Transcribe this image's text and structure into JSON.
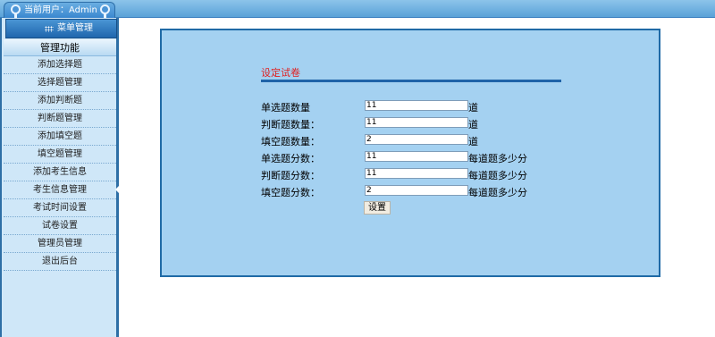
{
  "header": {
    "user_label": "当前用户：Admin",
    "menu_title": "菜单管理",
    "section_title": "管理功能"
  },
  "sidebar": {
    "items": [
      {
        "label": "添加选择题"
      },
      {
        "label": "选择题管理"
      },
      {
        "label": "添加判断题"
      },
      {
        "label": "判断题管理"
      },
      {
        "label": "添加填空题"
      },
      {
        "label": "填空题管理"
      },
      {
        "label": "添加考生信息"
      },
      {
        "label": "考生信息管理"
      },
      {
        "label": "考试时间设置"
      },
      {
        "label": "试卷设置"
      },
      {
        "label": "管理员管理"
      },
      {
        "label": "退出后台"
      }
    ]
  },
  "form": {
    "title": "设定试卷",
    "rows": [
      {
        "label": "单选题数量",
        "value": "11",
        "unit": "道"
      },
      {
        "label": "判断题数量：",
        "value": "11",
        "unit": "道"
      },
      {
        "label": "填空题数量：",
        "value": "2",
        "unit": "道"
      },
      {
        "label": "单选题分数：",
        "value": "11",
        "unit": "每道题多少分"
      },
      {
        "label": "判断题分数：",
        "value": "11",
        "unit": "每道题多少分"
      },
      {
        "label": "填空题分数：",
        "value": "2",
        "unit": "每道题多少分"
      }
    ],
    "submit_label": "设置"
  },
  "colors": {
    "panel_bg": "#a4d1f1",
    "panel_border": "#1f6aa6",
    "title_red": "#e02020",
    "sidebar_bg": "#cfe7f8"
  }
}
